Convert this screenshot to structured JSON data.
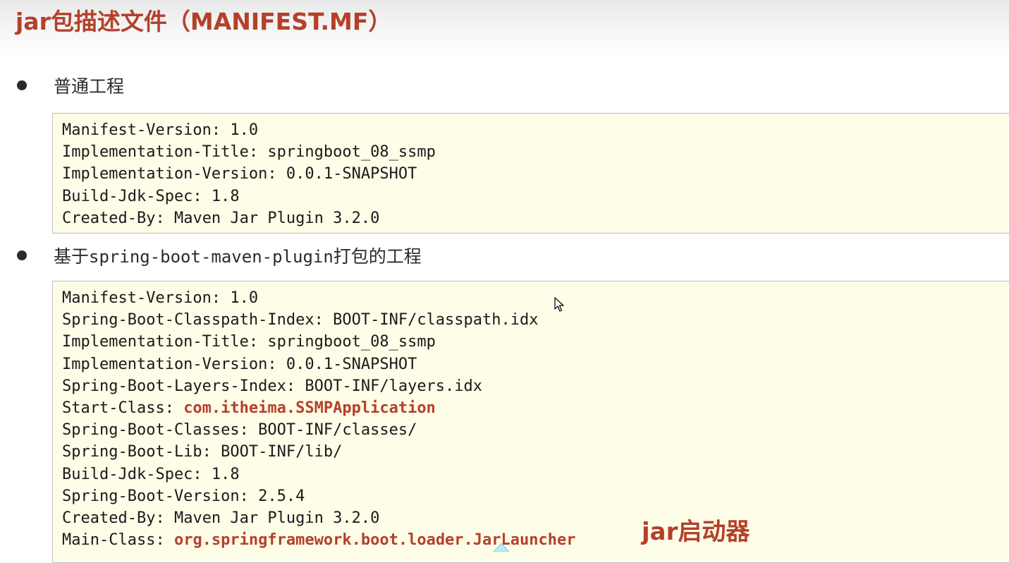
{
  "title": "jar包描述文件（MANIFEST.MF）",
  "sections": [
    {
      "bullet_parts": [
        "普通工程"
      ],
      "lines": [
        {
          "key": "Manifest-Version: ",
          "value": "1.0"
        },
        {
          "key": "Implementation-Title: ",
          "value": "springboot_08_ssmp"
        },
        {
          "key": "Implementation-Version: ",
          "value": "0.0.1-SNAPSHOT"
        },
        {
          "key": "Build-Jdk-Spec: ",
          "value": "1.8"
        },
        {
          "key": "Created-By: ",
          "value": "Maven Jar Plugin 3.2.0"
        }
      ]
    },
    {
      "bullet_parts": [
        "基于",
        "spring-boot-maven-plugin",
        "打包的工程"
      ],
      "lines": [
        {
          "key": "Manifest-Version: ",
          "value": "1.0"
        },
        {
          "key": "Spring-Boot-Classpath-Index: ",
          "value": "BOOT-INF/classpath.idx"
        },
        {
          "key": "Implementation-Title: ",
          "value": "springboot_08_ssmp"
        },
        {
          "key": "Implementation-Version: ",
          "value": "0.0.1-SNAPSHOT"
        },
        {
          "key": "Spring-Boot-Layers-Index: ",
          "value": "BOOT-INF/layers.idx"
        },
        {
          "key": "Start-Class: ",
          "value": "com.itheima.SSMPApplication",
          "highlight": true
        },
        {
          "key": "Spring-Boot-Classes: ",
          "value": "BOOT-INF/classes/"
        },
        {
          "key": "Spring-Boot-Lib: ",
          "value": "BOOT-INF/lib/"
        },
        {
          "key": "Build-Jdk-Spec: ",
          "value": "1.8"
        },
        {
          "key": "Spring-Boot-Version: ",
          "value": "2.5.4"
        },
        {
          "key": "Created-By: ",
          "value": "Maven Jar Plugin 3.2.0"
        },
        {
          "key": "Main-Class: ",
          "value": "org.springframework.boot.loader.JarLauncher",
          "highlight": true
        }
      ]
    }
  ],
  "annotation": "jar启动器",
  "colors": {
    "accent": "#b5402a",
    "code_background": "#fefde8",
    "code_border": "#bdbdbd",
    "text": "#1a1a1a"
  },
  "icons": [
    "mouse-cursor-icon"
  ]
}
